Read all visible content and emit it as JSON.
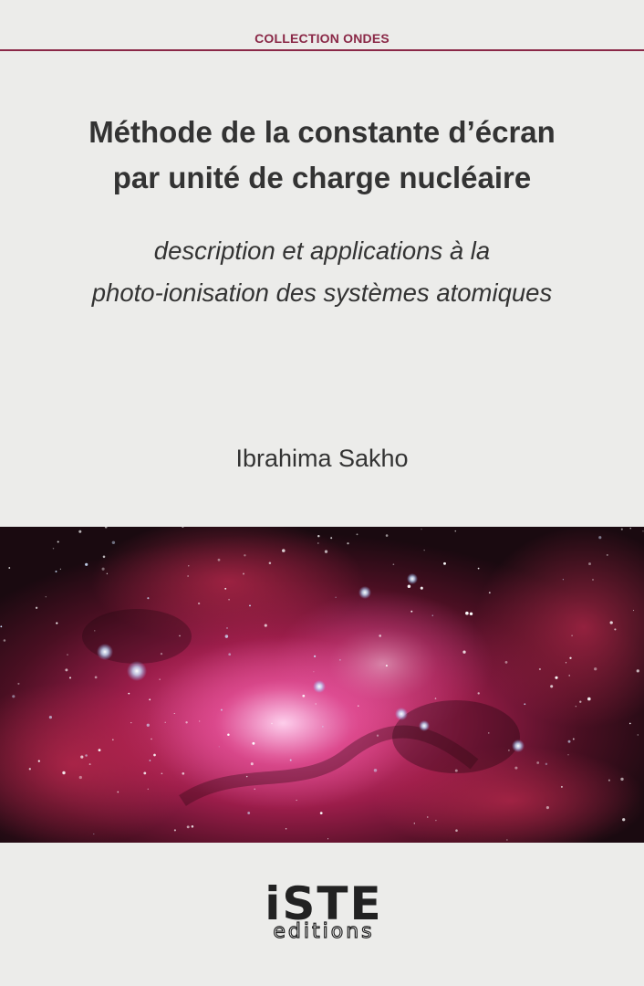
{
  "colors": {
    "accent": "#8a2847",
    "background": "#ececea",
    "text": "#333333"
  },
  "header": {
    "collection": "COLLECTION ONDES"
  },
  "book": {
    "title_lines": [
      "Méthode de la constante d’écran",
      "par unité de charge nucléaire"
    ],
    "subtitle_lines": [
      "description et applications à la",
      "photo-ionisation des systèmes atomiques"
    ],
    "author": "Ibrahima Sakho"
  },
  "publisher": {
    "logo_main": "iSTE",
    "logo_sub": "editions"
  }
}
